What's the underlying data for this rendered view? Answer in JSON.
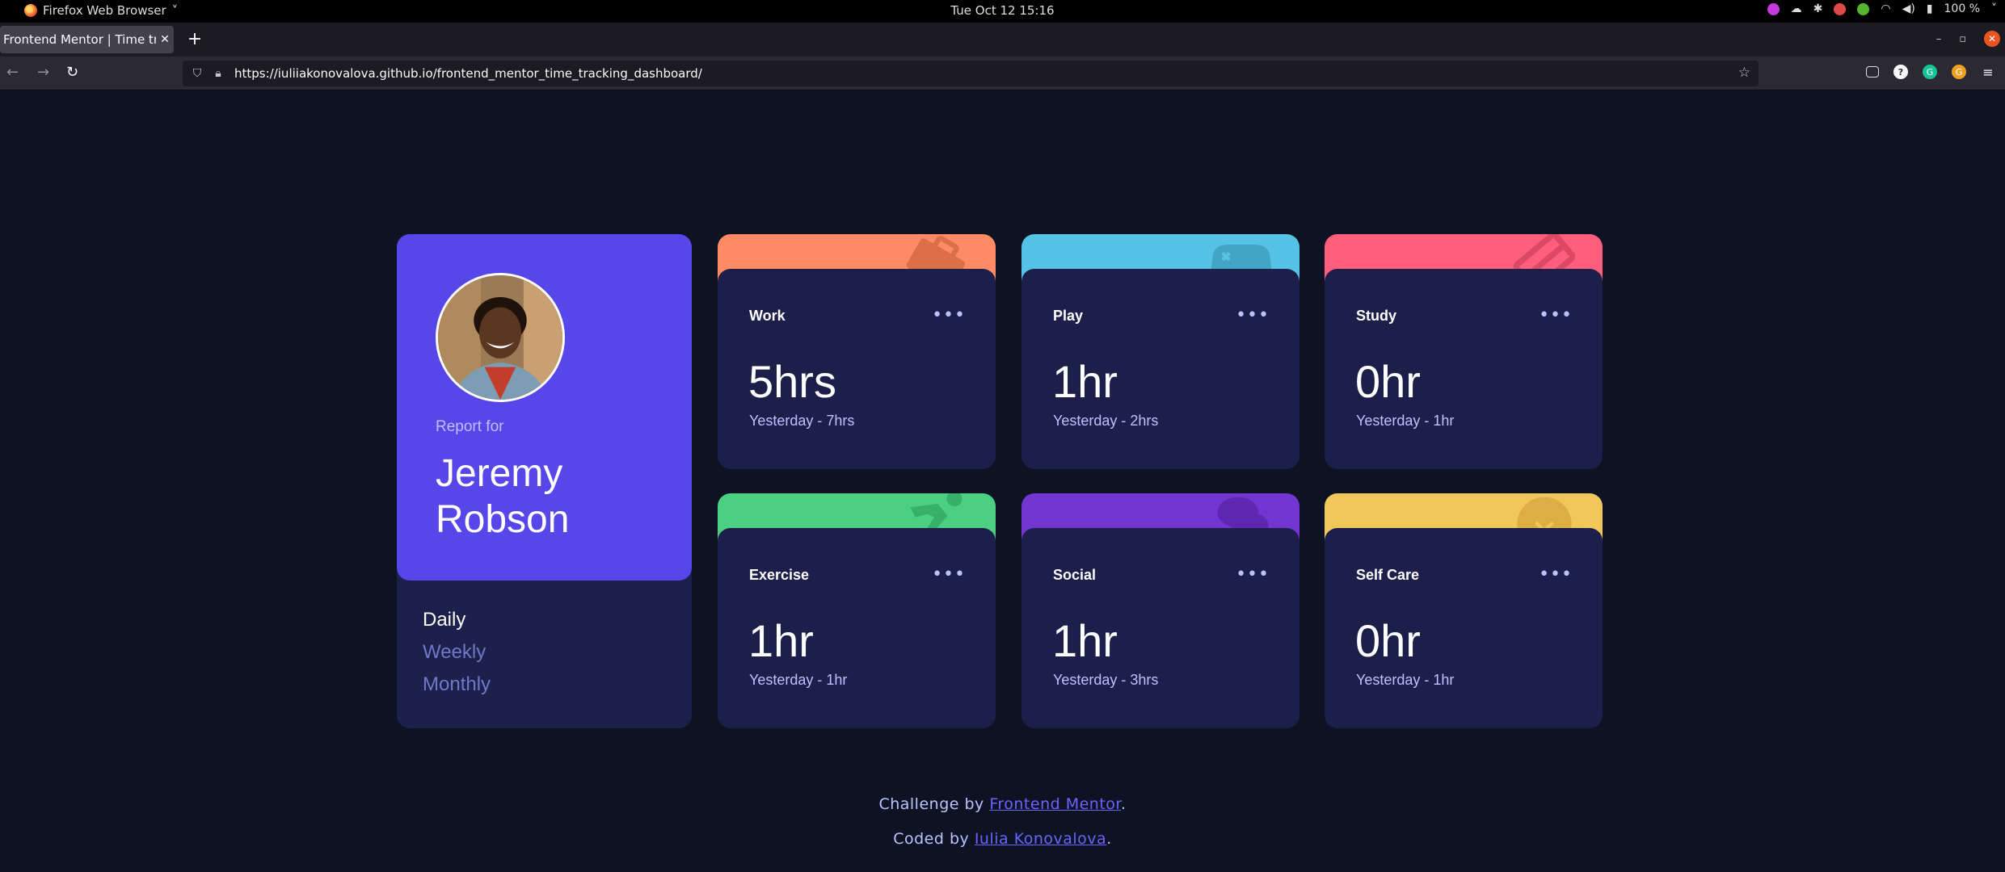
{
  "topbar": {
    "app_name": "Firefox Web Browser",
    "app_chevron": "˅",
    "clock": "Tue Oct 12  15:16",
    "battery": "100 %",
    "tray_icons": [
      "color-picker-icon",
      "weather-icon",
      "slack-icon",
      "tomato-icon",
      "check-icon",
      "wifi-icon",
      "volume-icon",
      "battery-icon",
      "chevron-down-icon"
    ]
  },
  "browser": {
    "tab_title": "Frontend Mentor | Time tracking dashboard",
    "tab_close": "✕",
    "new_tab": "+",
    "url": "https://iuliiakonovalova.github.io/frontend_mentor_time_tracking_dashboard/",
    "window_controls": {
      "minimize": "–",
      "maximize": "▫",
      "close": "✕"
    }
  },
  "profile": {
    "report_for": "Report for",
    "name": "Jeremy Robson",
    "periods": [
      {
        "label": "Daily",
        "active": true
      },
      {
        "label": "Weekly",
        "active": false
      },
      {
        "label": "Monthly",
        "active": false
      }
    ]
  },
  "cards": [
    {
      "title": "Work",
      "hours": "5hrs",
      "previous": "Yesterday - 7hrs",
      "color": "#ff8b64",
      "icon": "briefcase-icon"
    },
    {
      "title": "Play",
      "hours": "1hr",
      "previous": "Yesterday - 2hrs",
      "color": "#56c2e6",
      "icon": "gamepad-icon"
    },
    {
      "title": "Study",
      "hours": "0hr",
      "previous": "Yesterday - 1hr",
      "color": "#ff5e7d",
      "icon": "book-icon"
    },
    {
      "title": "Exercise",
      "hours": "1hr",
      "previous": "Yesterday - 1hr",
      "color": "#4bcf82",
      "icon": "running-icon"
    },
    {
      "title": "Social",
      "hours": "1hr",
      "previous": "Yesterday - 3hrs",
      "color": "#7335d2",
      "icon": "chat-icon"
    },
    {
      "title": "Self Care",
      "hours": "0hr",
      "previous": "Yesterday - 1hr",
      "color": "#f1c75b",
      "icon": "heart-icon"
    }
  ],
  "more_glyph": "•••",
  "footer": {
    "line1_prefix": "Challenge by ",
    "line1_link": "Frontend Mentor",
    "line1_suffix": ".",
    "line2_prefix": "Coded by ",
    "line2_link": "Iulia Konovalova",
    "line2_suffix": "."
  }
}
